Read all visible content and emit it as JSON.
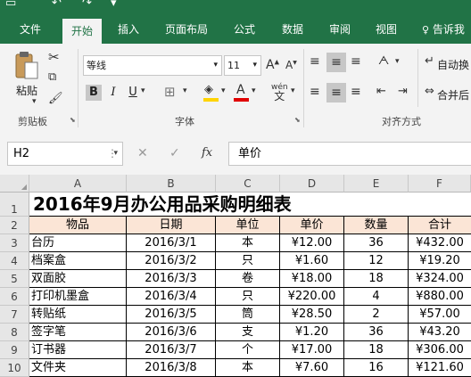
{
  "ribbon_tabs": [
    "文件",
    "开始",
    "插入",
    "页面布局",
    "公式",
    "数据",
    "审阅",
    "视图",
    "告诉我"
  ],
  "clipboard": {
    "paste_label": "粘贴",
    "group_label": "剪贴板"
  },
  "font": {
    "name": "等线",
    "size": "11",
    "group_label": "字体",
    "bold": "B",
    "italic": "I",
    "underline": "U",
    "grow": "A",
    "shrink": "A",
    "phonetic": "wén",
    "color_letter": "A"
  },
  "alignment": {
    "group_label": "对齐方式",
    "wrap_label": "自动换",
    "merge_label": "合并后"
  },
  "formula_bar": {
    "name_box": "H2",
    "fx": "fx",
    "value": "单价"
  },
  "columns": [
    "A",
    "B",
    "C",
    "D",
    "E",
    "F"
  ],
  "rows": [
    "1",
    "2",
    "3",
    "4",
    "5",
    "6",
    "7",
    "8",
    "9",
    "10"
  ],
  "sheet": {
    "title": "2016年9月办公用品采购明细表",
    "headers": [
      "物品",
      "日期",
      "单位",
      "单价",
      "数量",
      "合计"
    ],
    "data": [
      [
        "台历",
        "2016/3/1",
        "本",
        "¥12.00",
        "36",
        "¥432.00"
      ],
      [
        "档案盒",
        "2016/3/2",
        "只",
        "¥1.60",
        "12",
        "¥19.20"
      ],
      [
        "双面胶",
        "2016/3/3",
        "卷",
        "¥18.00",
        "18",
        "¥324.00"
      ],
      [
        "打印机墨盒",
        "2016/3/4",
        "只",
        "¥220.00",
        "4",
        "¥880.00"
      ],
      [
        "转贴纸",
        "2016/3/5",
        "筒",
        "¥28.50",
        "2",
        "¥57.00"
      ],
      [
        "签字笔",
        "2016/3/6",
        "支",
        "¥1.20",
        "36",
        "¥43.20"
      ],
      [
        "订书器",
        "2016/3/7",
        "个",
        "¥17.00",
        "18",
        "¥306.00"
      ],
      [
        "文件夹",
        "2016/3/8",
        "本",
        "¥7.60",
        "16",
        "¥121.60"
      ]
    ]
  },
  "colors": {
    "ribbon_green": "#217346",
    "header_fill": "#fbe5d6"
  }
}
